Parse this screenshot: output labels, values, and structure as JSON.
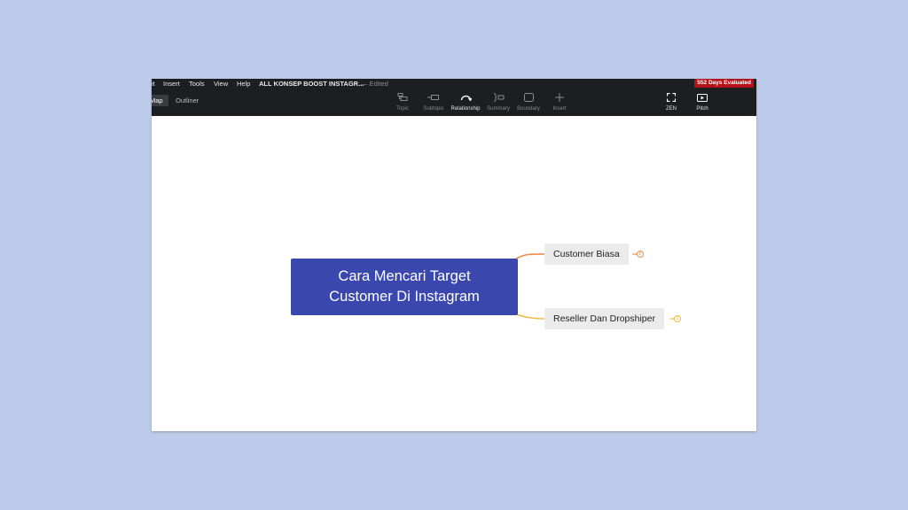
{
  "menu": {
    "items": [
      "it",
      "Insert",
      "Tools",
      "View",
      "Help"
    ],
    "document_title": "ALL KONSEP BOOST INSTAGR...",
    "status": "— Edited",
    "trial_badge": "552 Days Evaluated"
  },
  "view_tabs": {
    "map": "Map",
    "outliner": "Outliner"
  },
  "toolbar": {
    "topic": {
      "label": "Topic",
      "icon": "topic-icon"
    },
    "subtopic": {
      "label": "Subtopic",
      "icon": "subtopic-icon"
    },
    "relationship": {
      "label": "Relationship",
      "icon": "relationship-icon"
    },
    "summary": {
      "label": "Summary",
      "icon": "summary-icon"
    },
    "boundary": {
      "label": "Boundary",
      "icon": "boundary-icon"
    },
    "insert": {
      "label": "Insert",
      "icon": "plus-icon"
    },
    "zen": {
      "label": "ZEN",
      "icon": "fullscreen-icon"
    },
    "pitch": {
      "label": "Pitch",
      "icon": "play-icon"
    }
  },
  "mindmap": {
    "central": {
      "line1": "Cara Mencari Target",
      "line2": "Customer Di Instagram"
    },
    "subtopics": [
      {
        "label": "Customer Biasa",
        "collapsed_count": "6",
        "color": "#f08a4b"
      },
      {
        "label": "Reseller Dan Dropshiper",
        "collapsed_count": "3",
        "color": "#f5b942"
      }
    ]
  },
  "colors": {
    "background": "#bccbe9",
    "toolbar": "#1d1e21",
    "central_topic": "#3a47ad",
    "badge": "#b31219"
  }
}
